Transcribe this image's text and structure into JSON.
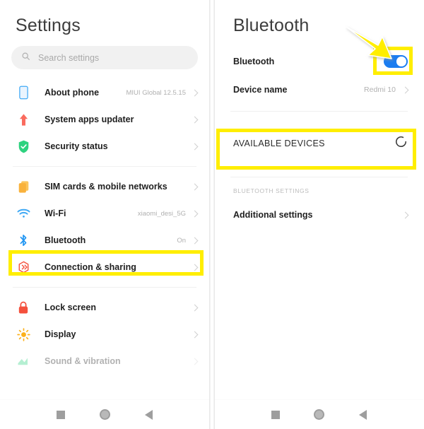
{
  "left_screen": {
    "title": "Settings",
    "search": {
      "placeholder": "Search settings",
      "icon": "search-icon"
    },
    "groups": [
      {
        "items": [
          {
            "icon": "phone-icon",
            "label": "About phone",
            "value": "MIUI Global 12.5.15",
            "chevron": true
          },
          {
            "icon": "arrow-up-icon",
            "label": "System apps updater",
            "value": "",
            "chevron": true
          },
          {
            "icon": "shield-check-icon",
            "label": "Security status",
            "value": "",
            "chevron": true
          }
        ]
      },
      {
        "items": [
          {
            "icon": "sim-card-icon",
            "label": "SIM cards & mobile networks",
            "value": "",
            "chevron": true
          },
          {
            "icon": "wifi-icon",
            "label": "Wi-Fi",
            "value": "xiaomi_desi_5G",
            "chevron": true
          },
          {
            "icon": "bluetooth-icon",
            "label": "Bluetooth",
            "value": "On",
            "chevron": true,
            "highlighted": true
          },
          {
            "icon": "connection-sharing-icon",
            "label": "Connection & sharing",
            "value": "",
            "chevron": true
          }
        ]
      },
      {
        "items": [
          {
            "icon": "lock-icon",
            "label": "Lock screen",
            "value": "",
            "chevron": true
          },
          {
            "icon": "display-icon",
            "label": "Display",
            "value": "",
            "chevron": true
          },
          {
            "icon": "sound-icon",
            "label": "Sound & vibration",
            "value": "",
            "chevron": true,
            "clipped": true
          }
        ]
      }
    ]
  },
  "right_screen": {
    "title": "Bluetooth",
    "bluetooth_toggle": {
      "label": "Bluetooth",
      "state": "on"
    },
    "device_name": {
      "label": "Device name",
      "value": "Redmi 10"
    },
    "available_devices": {
      "label": "AVAILABLE DEVICES",
      "icon": "refresh-spinner-icon"
    },
    "settings_section": {
      "header": "BLUETOOTH SETTINGS",
      "items": [
        {
          "label": "Additional settings",
          "chevron": true
        }
      ]
    }
  },
  "navbar": {
    "recents": "recents-button",
    "home": "home-button",
    "back": "back-button"
  },
  "annotations": {
    "highlight_color": "#ffee00",
    "arrow": "yellow-pointer-arrow",
    "toggle_on_color": "#1a7cf0"
  }
}
